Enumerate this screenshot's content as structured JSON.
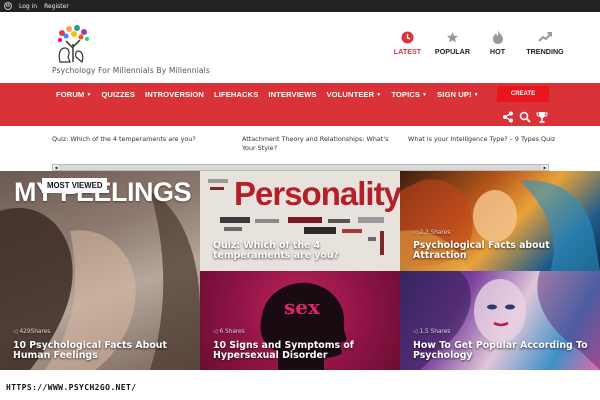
{
  "admin_bar": {
    "login": "Log in",
    "register": "Register"
  },
  "header": {
    "tagline": "Psychology For Millennials By Millennials",
    "feeds": [
      {
        "label": "LATEST",
        "icon": "clock-icon",
        "active": true
      },
      {
        "label": "POPULAR",
        "icon": "star-icon",
        "active": false
      },
      {
        "label": "HOT",
        "icon": "flame-icon",
        "active": false
      },
      {
        "label": "TRENDING",
        "icon": "trending-up-icon",
        "active": false
      }
    ]
  },
  "nav": {
    "items": [
      "FORUM",
      "QUIZZES",
      "INTROVERSION",
      "LIFEHACKS",
      "INTERVIEWS",
      "VOLUNTEER",
      "TOPICS",
      "SIGN UP!"
    ],
    "create": "CREATE"
  },
  "strip": {
    "items": [
      "Quiz: Which of the 4 temperaments are you?",
      "Attachment Theory and Relationships: What's Your Style?",
      "What is your Intelligence Type? – 9 Types Quiz"
    ]
  },
  "grid": {
    "badge": "MOST VIEWED",
    "tiles": [
      {
        "title": "10 Psychological Facts About Human Feelings",
        "shares": "429Shares",
        "image_text": "MY FEELINGS"
      },
      {
        "title": "Quiz: Which of the 4 temperaments are you?",
        "shares": "",
        "image_text": "Personality"
      },
      {
        "title": "Psychological Facts about Attraction",
        "shares": "2.3 Shares",
        "image_text": ""
      },
      {
        "title": "10 Signs and Symptoms of Hypersexual Disorder",
        "shares": "6 Shares",
        "image_text": "sex"
      },
      {
        "title": "How To Get Popular According To Psychology",
        "shares": "1.5 Shares",
        "image_text": ""
      }
    ]
  },
  "footer": {
    "url": "HTTPS://WWW.PSYCH2GO.NET/"
  },
  "colors": {
    "brand_red": "#d93339",
    "admin_bar": "#222222"
  }
}
